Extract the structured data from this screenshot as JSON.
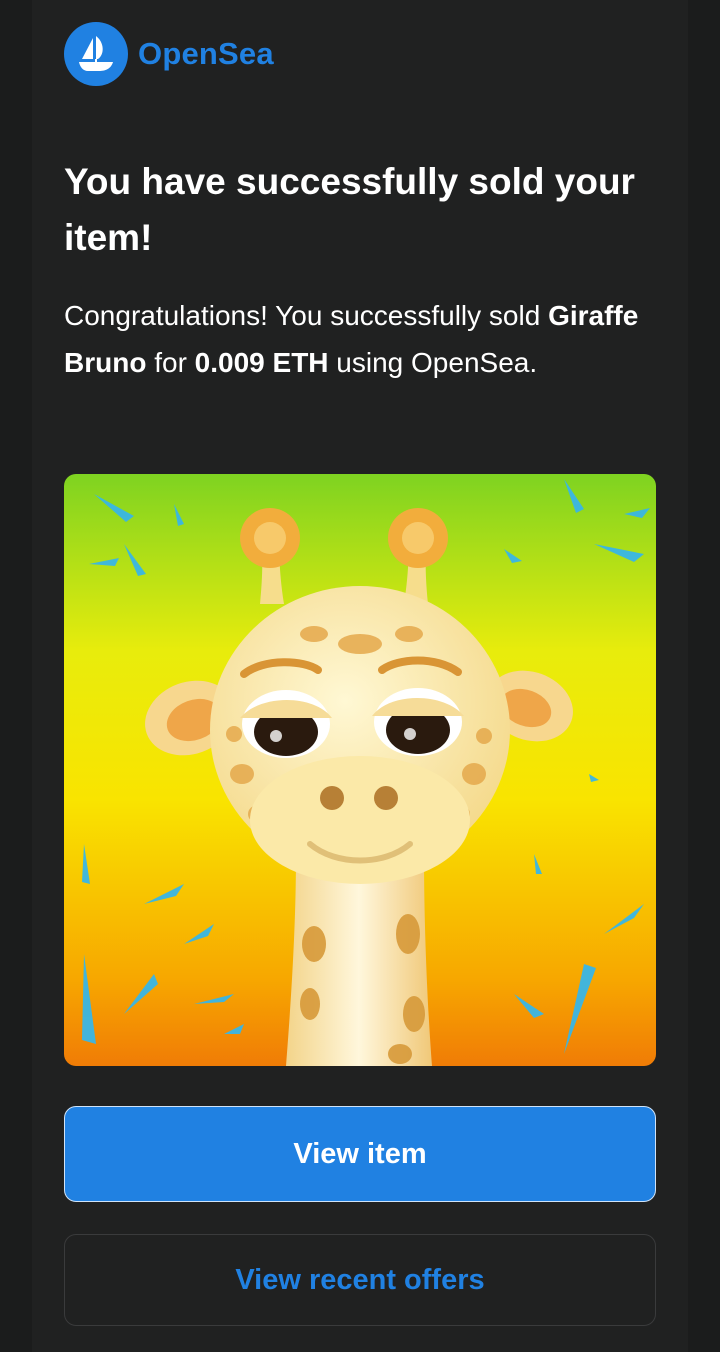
{
  "brand": {
    "name": "OpenSea",
    "color": "#2081e2",
    "logo_icon": "opensea-ship-icon"
  },
  "email": {
    "headline": "You have successfully sold your item!",
    "message": {
      "prefix": "Congratulations! You successfully sold ",
      "item_name": "Giraffe Bruno",
      "middle": " for ",
      "price": "0.009 ETH",
      "suffix": " using OpenSea."
    },
    "item_image": "nft-giraffe-image"
  },
  "actions": {
    "view_item_label": "View item",
    "view_offers_label": "View recent offers"
  },
  "colors": {
    "background": "#1b1c1c",
    "card": "#202121",
    "text": "#ffffff",
    "accent": "#2081e2"
  }
}
